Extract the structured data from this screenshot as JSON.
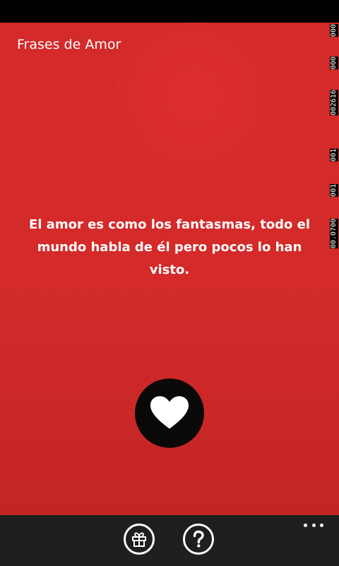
{
  "app": {
    "title": "Frases de Amor"
  },
  "quote": {
    "text": "El amor es como los fantasmas, todo el mundo habla de él pero pocos lo han visto."
  },
  "buttons": {
    "favorite_icon": "heart-icon",
    "gift_icon": "gift-icon",
    "help_icon": "question-icon",
    "more_icon": "more-dots-icon"
  },
  "debug_counters": [
    "000",
    "000",
    "002616",
    "001",
    "001",
    "00.0700"
  ],
  "colors": {
    "background": "#d42a2a",
    "app_bar": "#1f1f1f",
    "favorite_button": "#0b0808",
    "text": "#ffffff"
  }
}
